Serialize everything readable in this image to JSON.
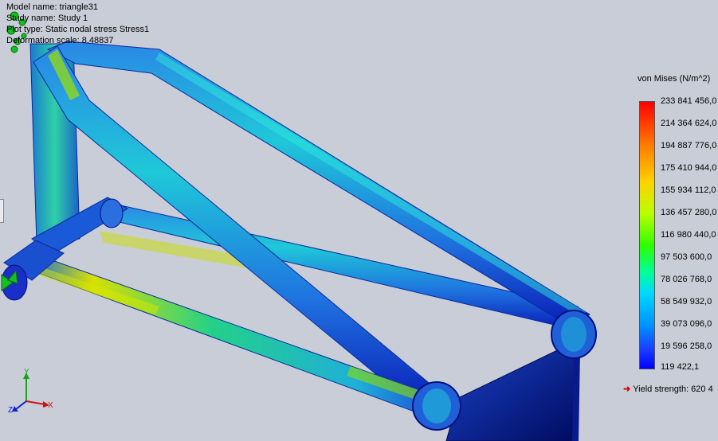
{
  "study_info": {
    "model_name": "Model name: triangle31",
    "study_name": "Study name: Study 1",
    "plot_type": "Plot type: Static nodal stress Stress1",
    "deformation_scale": "Deformation scale: 8.48837"
  },
  "legend": {
    "title": "von Mises (N/m^2)",
    "ticks": [
      "233 841 456,0",
      "214 364 624,0",
      "194 887 776,0",
      "175 410 944,0",
      "155 934 112,0",
      "136 457 280,0",
      "116 980 440,0",
      "97 503 600,0",
      "78 026 768,0",
      "58 549 932,0",
      "39 073 096,0",
      "19 596 258,0",
      "119 422,1"
    ],
    "yield_strength": "Yield strength: 620 4"
  },
  "triad": {
    "y": "Y",
    "z": "Z",
    "x": "X"
  },
  "colors": {
    "background": "#c9cdd8",
    "stress_low": "#0000ff",
    "stress_high": "#ff0000",
    "yield_arrow": "#e00000"
  },
  "icons": [
    "fixture-arrow-icon",
    "coordinate-triad-icon",
    "yield-arrow-icon"
  ]
}
